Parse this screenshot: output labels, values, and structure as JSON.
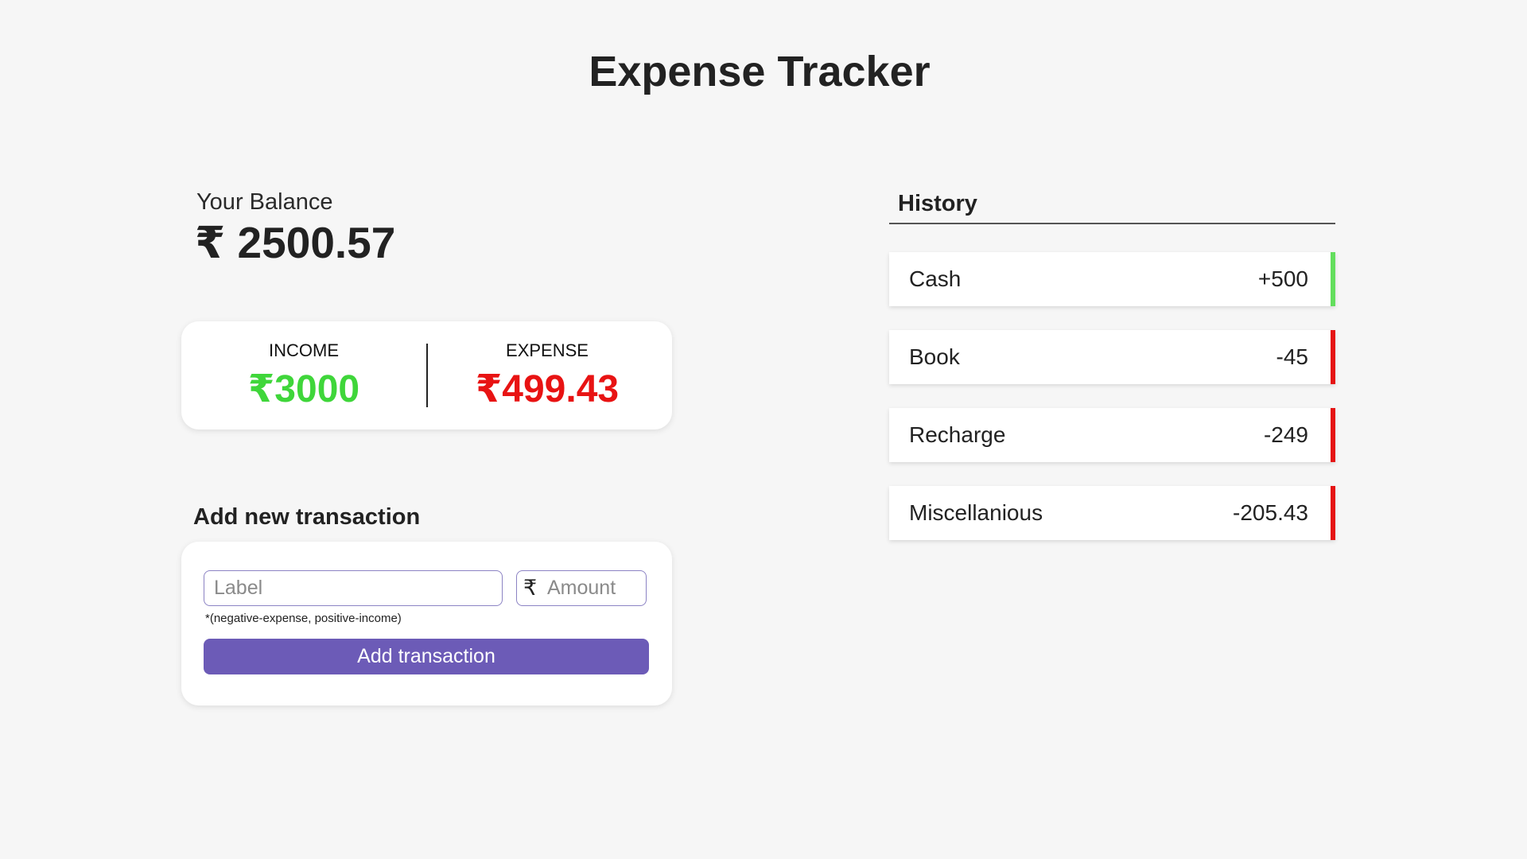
{
  "header": {
    "title": "Expense Tracker"
  },
  "balance": {
    "label": "Your Balance",
    "value": "₹ 2500.57"
  },
  "summary": {
    "income_label": "INCOME",
    "income_value": "₹3000",
    "expense_label": "EXPENSE",
    "expense_value": "₹499.43",
    "income_color": "#3fd63a",
    "expense_color": "#e81313"
  },
  "form": {
    "heading": "Add new transaction",
    "label_placeholder": "Label",
    "currency_icon": "rupee-icon",
    "currency_symbol": "₹",
    "amount_placeholder": "Amount",
    "hint": "*(negative-expense, positive-income)",
    "button_label": "Add transaction",
    "button_color": "#6c5bb7"
  },
  "history": {
    "heading": "History",
    "items": [
      {
        "label": "Cash",
        "amount": "+500",
        "type": "income"
      },
      {
        "label": "Book",
        "amount": "-45",
        "type": "expense"
      },
      {
        "label": "Recharge",
        "amount": "-249",
        "type": "expense"
      },
      {
        "label": "Miscellanious",
        "amount": "-205.43",
        "type": "expense"
      }
    ]
  }
}
